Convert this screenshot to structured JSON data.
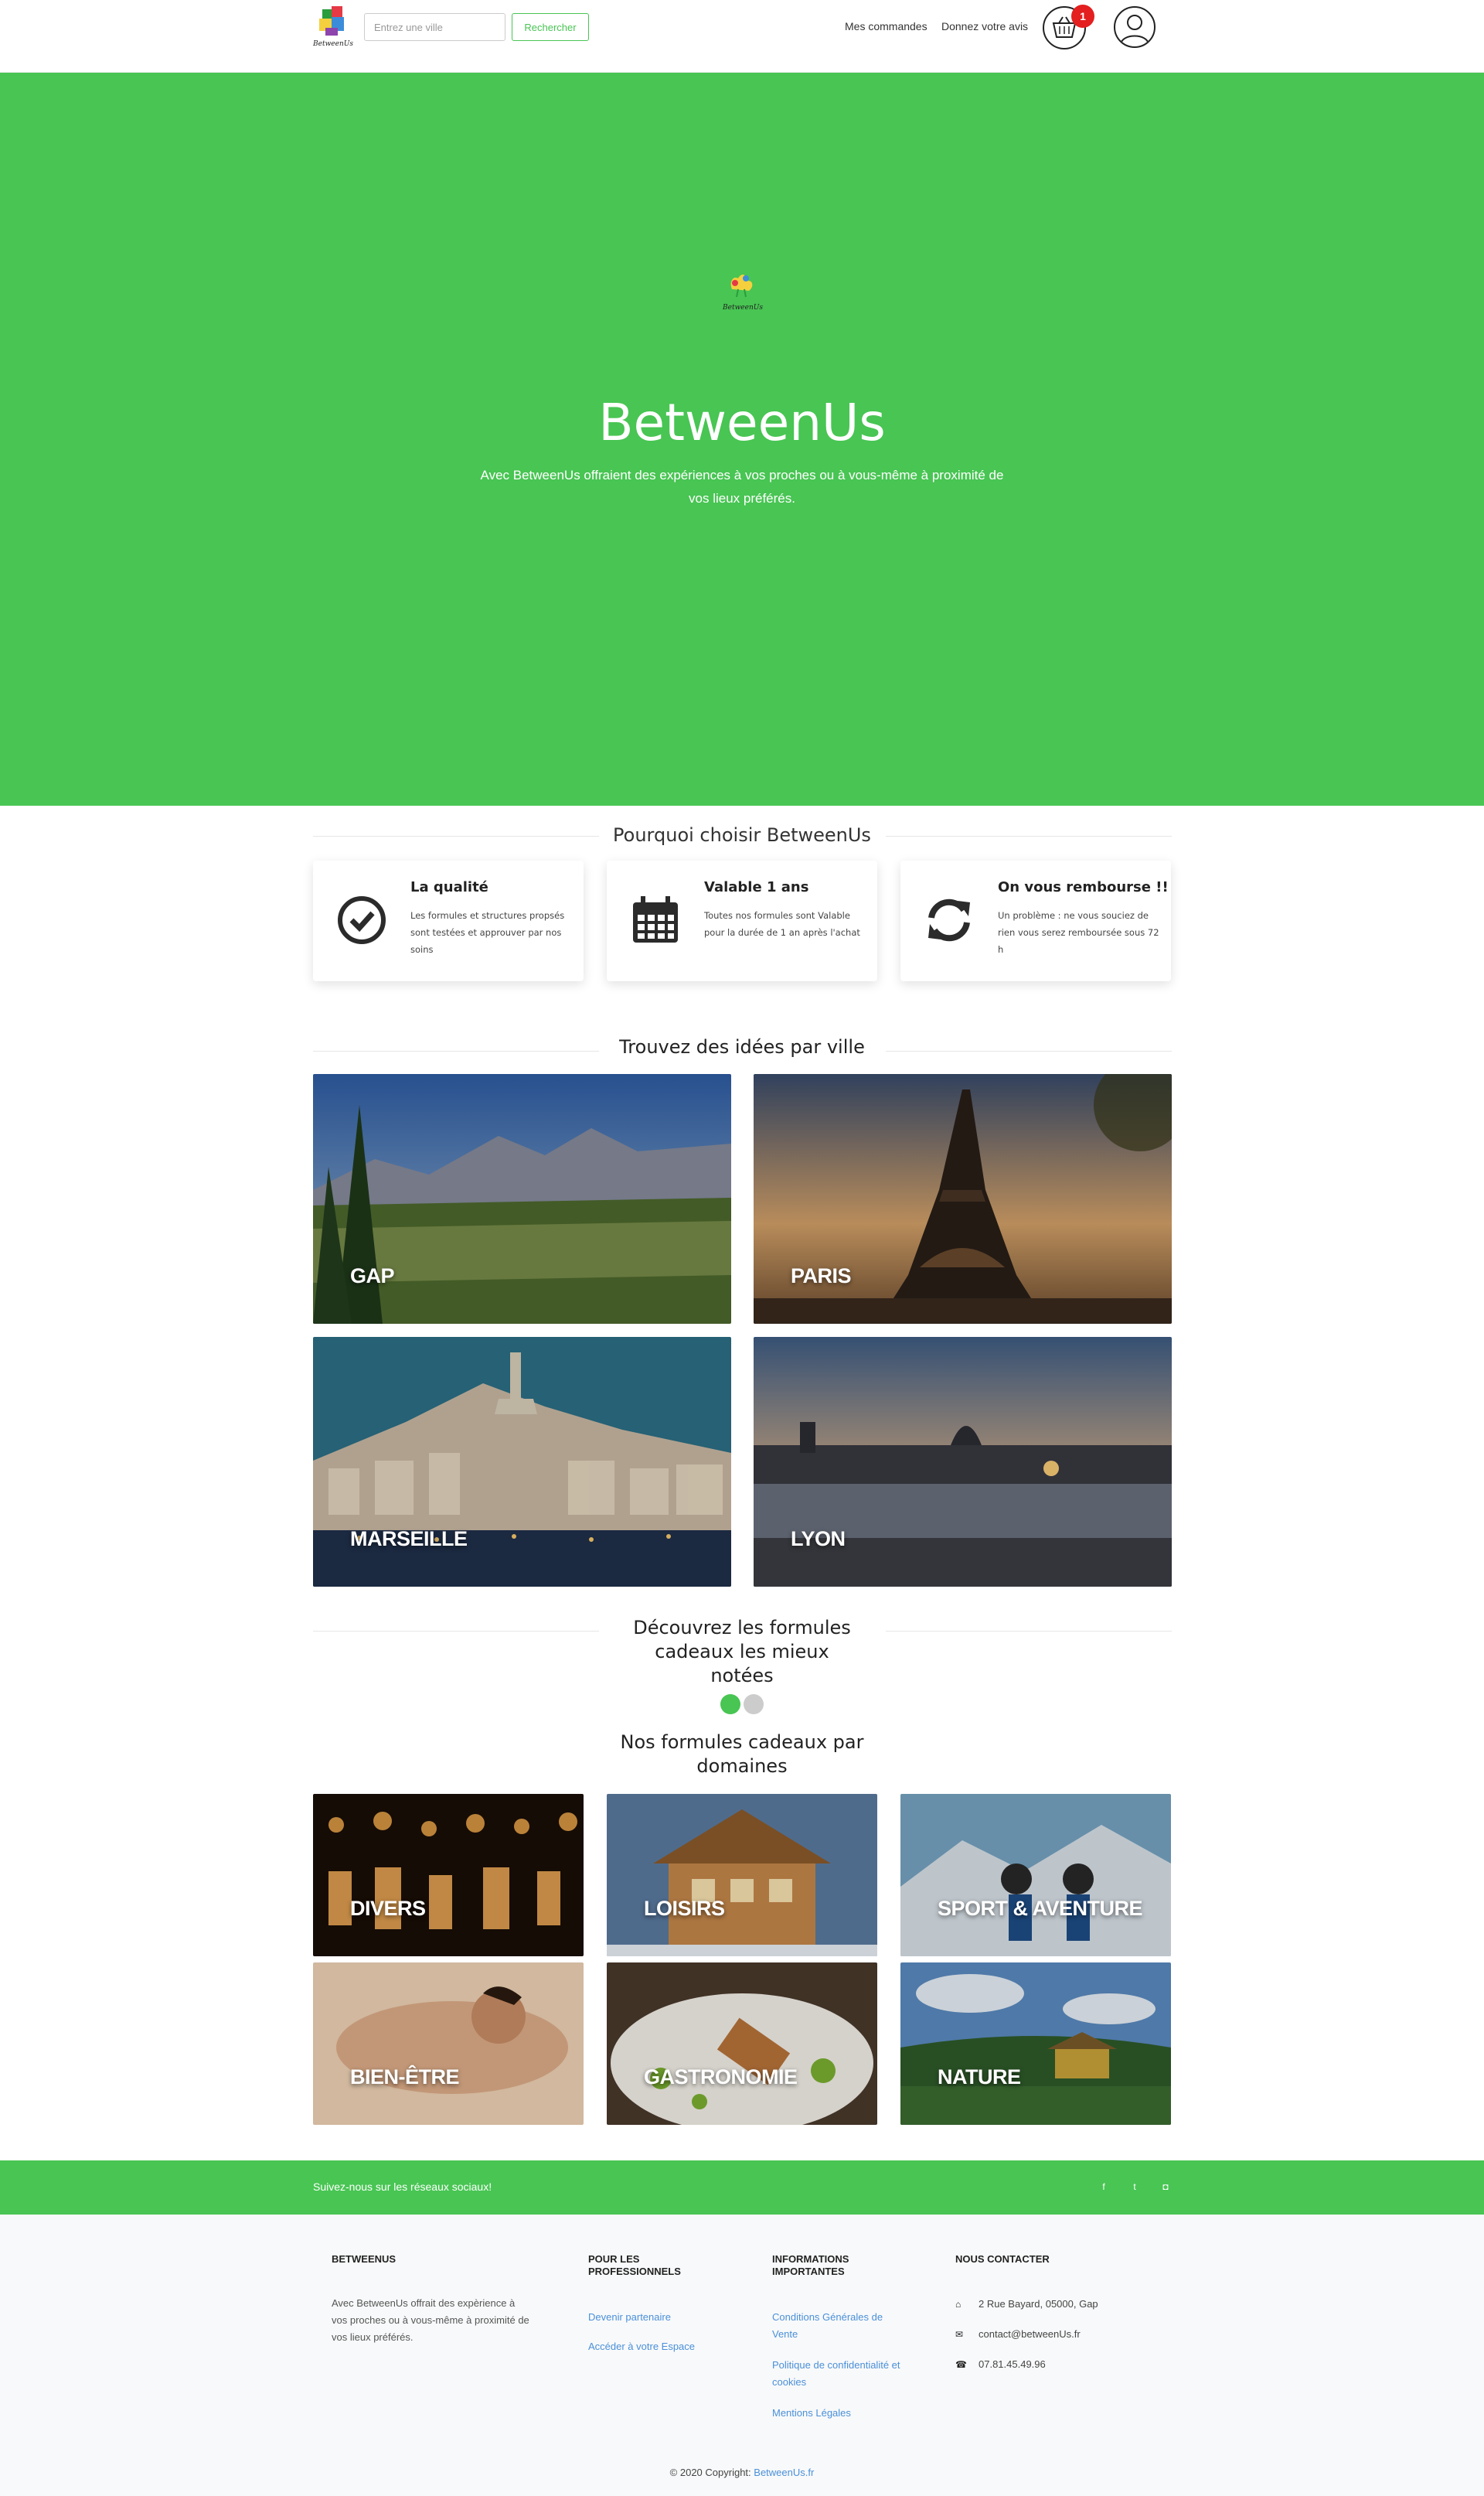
{
  "brand": {
    "name": "BetweenUs",
    "logo_text": "BetweenUs",
    "green": "#48c553"
  },
  "navbar": {
    "search_placeholder": "Entrez une ville",
    "search_button": "Rechercher",
    "links": [
      "Mes commandes",
      "Donnez votre avis"
    ],
    "basket_count": "1",
    "icons": [
      "basket-icon",
      "user-icon"
    ]
  },
  "hero": {
    "title": "BetweenUs",
    "subtitle": "Avec BetweenUs offraient des expériences à vos proches ou à vous-même à proximité de vos lieux préférés."
  },
  "why": {
    "title": "Pourquoi choisir BetweenUs",
    "features": [
      {
        "title": "La qualité",
        "text": "Les formules et structures propsés sont testées et approuver par nos soins",
        "icon": "check-circle-icon"
      },
      {
        "title": "Valable 1 ans",
        "text": "Toutes nos formules sont Valable pour la durée de 1 an après l'achat",
        "icon": "calendar-icon"
      },
      {
        "title": "On vous rembourse !!",
        "text": "Un problème : ne vous souciez de rien vous serez remboursée sous 72 h",
        "icon": "refresh-icon"
      }
    ]
  },
  "cities": {
    "title": "Trouvez des idées par ville",
    "items": [
      "GAP",
      "PARIS",
      "MARSEILLE",
      "LYON"
    ]
  },
  "top_rated": {
    "title": "Découvrez les formules cadeaux les mieux notées"
  },
  "domains": {
    "title": "Nos formules cadeaux par domaines",
    "items": [
      "DIVERS",
      "LOISIRS",
      "SPORT & AVENTURE",
      "BIEN-ÊTRE",
      "GASTRONOMIE",
      "NATURE"
    ]
  },
  "social": {
    "text": "Suivez-nous sur les réseaux sociaux!",
    "icons": [
      "facebook-icon",
      "twitter-icon",
      "instagram-icon"
    ],
    "glyphs": [
      "f",
      "t",
      "◘"
    ]
  },
  "footer": {
    "col1": {
      "title": "BETWEENUS",
      "text": "Avec BetweenUs offrait des expèrience à vos proches ou à vous-même à proximité de vos lieux préférés."
    },
    "col2": {
      "title": "POUR LES PROFESSIONNELS",
      "links": [
        "Devenir partenaire",
        "Accéder à votre Espace"
      ]
    },
    "col3": {
      "title": "INFORMATIONS IMPORTANTES",
      "links": [
        "Conditions Générales de Vente",
        "Politique de confidentialité et cookies",
        "Mentions Légales"
      ]
    },
    "col4": {
      "title": "NOUS CONTACTER",
      "address": "2 Rue Bayard, 05000, Gap",
      "email": "contact@betweenUs.fr",
      "phone": "07.81.45.49.96"
    },
    "copyright_prefix": "© 2020 Copyright:",
    "copyright_link": "BetweenUs.fr"
  }
}
